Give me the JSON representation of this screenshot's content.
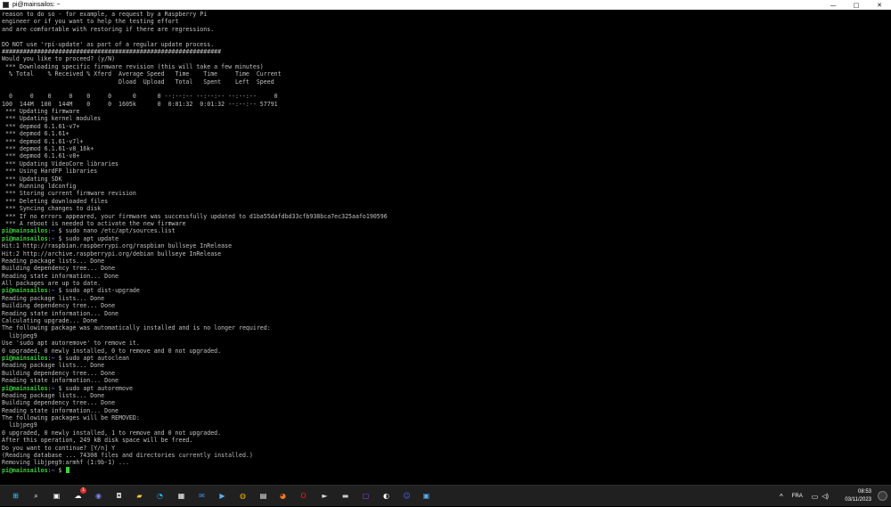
{
  "window": {
    "title": "pi@mainsailos: ~",
    "controls": {
      "minimize": "—",
      "maximize": "□",
      "close": "✕"
    }
  },
  "terminal": {
    "lines": [
      {
        "text": "reason to do so - for example, a request by a Raspberry Pi"
      },
      {
        "text": "engineer or if you want to help the testing effort"
      },
      {
        "text": "and are comfortable with restoring if there are regressions."
      },
      {
        "text": ""
      },
      {
        "text": "DO NOT use 'rpi-update' as part of a regular update process."
      },
      {
        "text": "##############################################################"
      },
      {
        "text": "Would you like to proceed? (y/N)"
      },
      {
        "text": " *** Downloading specific firmware revision (this will take a few minutes)"
      },
      {
        "text": "  % Total    % Received % Xferd  Average Speed   Time    Time     Time  Current"
      },
      {
        "text": "                                 Dload  Upload   Total   Spent    Left  Speed"
      },
      {
        "text": ""
      },
      {
        "text": "  0     0    0     0    0     0      0      0 --:--:-- --:--:-- --:--:--     0"
      },
      {
        "text": "100  144M  100  144M    0     0  1605k      0  0:01:32  0:01:32 --:--:-- 57791"
      },
      {
        "text": " *** Updating firmware"
      },
      {
        "text": " *** Updating kernel modules"
      },
      {
        "text": " *** depmod 6.1.61-v7+"
      },
      {
        "text": " *** depmod 6.1.61+"
      },
      {
        "text": " *** depmod 6.1.61-v7l+"
      },
      {
        "text": " *** depmod 6.1.61-v8_16k+"
      },
      {
        "text": " *** depmod 6.1.61-v8+"
      },
      {
        "text": " *** Updating VideoCore libraries"
      },
      {
        "text": " *** Using HardFP libraries"
      },
      {
        "text": " *** Updating SDK"
      },
      {
        "text": " *** Running ldconfig"
      },
      {
        "text": " *** Storing current firmware revision"
      },
      {
        "text": " *** Deleting downloaded files"
      },
      {
        "text": " *** Syncing changes to disk"
      },
      {
        "text": " *** If no errors appeared, your firmware was successfully updated to d1ba55dafdbd33cfb938bca7ec325aafo190596"
      },
      {
        "text": " *** A reboot is needed to activate the new firmware"
      },
      {
        "prompt": "pi@mainsailos",
        "path": "~",
        "text": "sudo nano /etc/apt/sources.list"
      },
      {
        "prompt": "pi@mainsailos",
        "path": "~",
        "text": "sudo apt update"
      },
      {
        "text": "Hit:1 http://raspbian.raspberrypi.org/raspbian bullseye InRelease"
      },
      {
        "text": "Hit:2 http://archive.raspberrypi.org/debian bullseye InRelease"
      },
      {
        "text": "Reading package lists... Done"
      },
      {
        "text": "Building dependency tree... Done"
      },
      {
        "text": "Reading state information... Done"
      },
      {
        "text": "All packages are up to date."
      },
      {
        "prompt": "pi@mainsailos",
        "path": "~",
        "text": "sudo apt dist-upgrade"
      },
      {
        "text": "Reading package lists... Done"
      },
      {
        "text": "Building dependency tree... Done"
      },
      {
        "text": "Reading state information... Done"
      },
      {
        "text": "Calculating upgrade... Done"
      },
      {
        "text": "The following package was automatically installed and is no longer required:"
      },
      {
        "text": "  libjpeg9"
      },
      {
        "text": "Use 'sudo apt autoremove' to remove it."
      },
      {
        "text": "0 upgraded, 0 newly installed, 0 to remove and 0 not upgraded."
      },
      {
        "prompt": "pi@mainsailos",
        "path": "~",
        "text": "sudo apt autoclean"
      },
      {
        "text": "Reading package lists... Done"
      },
      {
        "text": "Building dependency tree... Done"
      },
      {
        "text": "Reading state information... Done"
      },
      {
        "prompt": "pi@mainsailos",
        "path": "~",
        "text": "sudo apt autoremove"
      },
      {
        "text": "Reading package lists... Done"
      },
      {
        "text": "Building dependency tree... Done"
      },
      {
        "text": "Reading state information... Done"
      },
      {
        "text": "The following packages will be REMOVED:"
      },
      {
        "text": "  libjpeg9"
      },
      {
        "text": "0 upgraded, 0 newly installed, 1 to remove and 0 not upgraded."
      },
      {
        "text": "After this operation, 249 kB disk space will be freed."
      },
      {
        "text": "Do you want to continue? [Y/n] Y"
      },
      {
        "text": "(Reading database ... 74308 files and directories currently installed.)"
      },
      {
        "text": "Removing libjpeg9:armhf (1:9b-1) ..."
      },
      {
        "prompt": "pi@mainsailos",
        "path": "~",
        "text": "",
        "cursor": true
      }
    ]
  },
  "taskbar": {
    "icons": [
      {
        "name": "start-icon",
        "glyph": "⊞",
        "color": "#4cc2ff"
      },
      {
        "name": "search-icon",
        "glyph": "⌕",
        "color": "#ffffff"
      },
      {
        "name": "task-view-icon",
        "glyph": "▣",
        "color": "#ffffff"
      },
      {
        "name": "widgets-icon",
        "glyph": "☁",
        "color": "#ffffff",
        "badge": "1"
      },
      {
        "name": "teams-chat-icon",
        "glyph": "◉",
        "color": "#7b83eb"
      },
      {
        "name": "camera-icon",
        "glyph": "◘",
        "color": "#cfcfcf"
      },
      {
        "name": "file-explorer-icon",
        "glyph": "▰",
        "color": "#f4c542"
      },
      {
        "name": "edge-icon",
        "glyph": "◔",
        "color": "#2fb0e8"
      },
      {
        "name": "store-icon",
        "glyph": "▦",
        "color": "#ffffff"
      },
      {
        "name": "mail-icon",
        "glyph": "✉",
        "color": "#3b8fe8"
      },
      {
        "name": "photos-icon",
        "glyph": "▶",
        "color": "#5ab0f0"
      },
      {
        "name": "chrome-icon",
        "glyph": "◍",
        "color": "#f0b400"
      },
      {
        "name": "notes-icon",
        "glyph": "▤",
        "color": "#ffffff"
      },
      {
        "name": "firefox-icon",
        "glyph": "◕",
        "color": "#ff7b22"
      },
      {
        "name": "opera-icon",
        "glyph": "O",
        "color": "#ff1b2d"
      },
      {
        "name": "media-player-icon",
        "glyph": "►",
        "color": "#dddddd"
      },
      {
        "name": "app-icon",
        "glyph": "▬",
        "color": "#cccccc"
      },
      {
        "name": "twitch-icon",
        "glyph": "▢",
        "color": "#9146ff"
      },
      {
        "name": "steam-icon",
        "glyph": "◐",
        "color": "#ffffff"
      },
      {
        "name": "discord-icon",
        "glyph": "☺",
        "color": "#5865f2"
      },
      {
        "name": "terminal-icon",
        "glyph": "▣",
        "color": "#5ab0f0"
      }
    ],
    "tray": {
      "chevron": "^",
      "language": "FRA",
      "network_glyph": "▭",
      "volume_glyph": "◁)"
    },
    "clock": {
      "time": "08:53",
      "date": "03/11/2023"
    }
  }
}
